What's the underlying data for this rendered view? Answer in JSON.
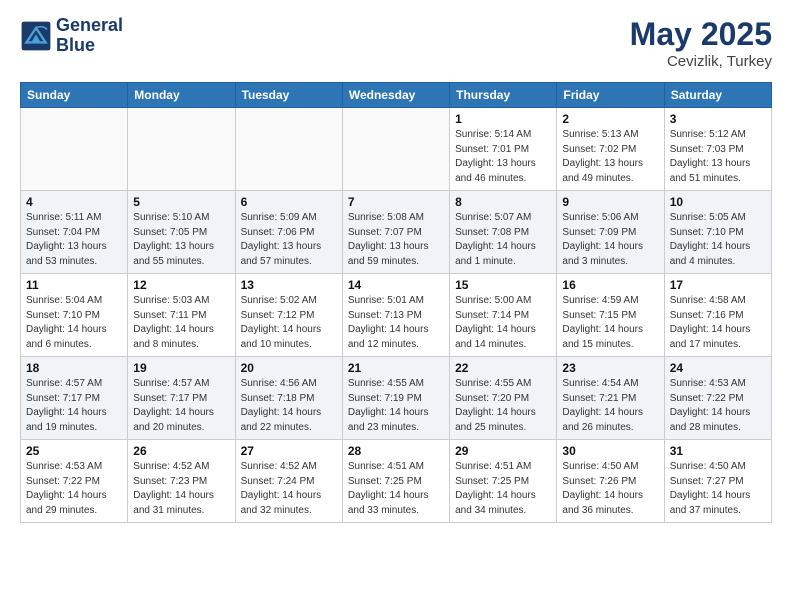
{
  "header": {
    "logo_line1": "General",
    "logo_line2": "Blue",
    "month_year": "May 2025",
    "location": "Cevizlik, Turkey"
  },
  "days_of_week": [
    "Sunday",
    "Monday",
    "Tuesday",
    "Wednesday",
    "Thursday",
    "Friday",
    "Saturday"
  ],
  "weeks": [
    [
      {
        "day": "",
        "info": ""
      },
      {
        "day": "",
        "info": ""
      },
      {
        "day": "",
        "info": ""
      },
      {
        "day": "",
        "info": ""
      },
      {
        "day": "1",
        "info": "Sunrise: 5:14 AM\nSunset: 7:01 PM\nDaylight: 13 hours\nand 46 minutes."
      },
      {
        "day": "2",
        "info": "Sunrise: 5:13 AM\nSunset: 7:02 PM\nDaylight: 13 hours\nand 49 minutes."
      },
      {
        "day": "3",
        "info": "Sunrise: 5:12 AM\nSunset: 7:03 PM\nDaylight: 13 hours\nand 51 minutes."
      }
    ],
    [
      {
        "day": "4",
        "info": "Sunrise: 5:11 AM\nSunset: 7:04 PM\nDaylight: 13 hours\nand 53 minutes."
      },
      {
        "day": "5",
        "info": "Sunrise: 5:10 AM\nSunset: 7:05 PM\nDaylight: 13 hours\nand 55 minutes."
      },
      {
        "day": "6",
        "info": "Sunrise: 5:09 AM\nSunset: 7:06 PM\nDaylight: 13 hours\nand 57 minutes."
      },
      {
        "day": "7",
        "info": "Sunrise: 5:08 AM\nSunset: 7:07 PM\nDaylight: 13 hours\nand 59 minutes."
      },
      {
        "day": "8",
        "info": "Sunrise: 5:07 AM\nSunset: 7:08 PM\nDaylight: 14 hours\nand 1 minute."
      },
      {
        "day": "9",
        "info": "Sunrise: 5:06 AM\nSunset: 7:09 PM\nDaylight: 14 hours\nand 3 minutes."
      },
      {
        "day": "10",
        "info": "Sunrise: 5:05 AM\nSunset: 7:10 PM\nDaylight: 14 hours\nand 4 minutes."
      }
    ],
    [
      {
        "day": "11",
        "info": "Sunrise: 5:04 AM\nSunset: 7:10 PM\nDaylight: 14 hours\nand 6 minutes."
      },
      {
        "day": "12",
        "info": "Sunrise: 5:03 AM\nSunset: 7:11 PM\nDaylight: 14 hours\nand 8 minutes."
      },
      {
        "day": "13",
        "info": "Sunrise: 5:02 AM\nSunset: 7:12 PM\nDaylight: 14 hours\nand 10 minutes."
      },
      {
        "day": "14",
        "info": "Sunrise: 5:01 AM\nSunset: 7:13 PM\nDaylight: 14 hours\nand 12 minutes."
      },
      {
        "day": "15",
        "info": "Sunrise: 5:00 AM\nSunset: 7:14 PM\nDaylight: 14 hours\nand 14 minutes."
      },
      {
        "day": "16",
        "info": "Sunrise: 4:59 AM\nSunset: 7:15 PM\nDaylight: 14 hours\nand 15 minutes."
      },
      {
        "day": "17",
        "info": "Sunrise: 4:58 AM\nSunset: 7:16 PM\nDaylight: 14 hours\nand 17 minutes."
      }
    ],
    [
      {
        "day": "18",
        "info": "Sunrise: 4:57 AM\nSunset: 7:17 PM\nDaylight: 14 hours\nand 19 minutes."
      },
      {
        "day": "19",
        "info": "Sunrise: 4:57 AM\nSunset: 7:17 PM\nDaylight: 14 hours\nand 20 minutes."
      },
      {
        "day": "20",
        "info": "Sunrise: 4:56 AM\nSunset: 7:18 PM\nDaylight: 14 hours\nand 22 minutes."
      },
      {
        "day": "21",
        "info": "Sunrise: 4:55 AM\nSunset: 7:19 PM\nDaylight: 14 hours\nand 23 minutes."
      },
      {
        "day": "22",
        "info": "Sunrise: 4:55 AM\nSunset: 7:20 PM\nDaylight: 14 hours\nand 25 minutes."
      },
      {
        "day": "23",
        "info": "Sunrise: 4:54 AM\nSunset: 7:21 PM\nDaylight: 14 hours\nand 26 minutes."
      },
      {
        "day": "24",
        "info": "Sunrise: 4:53 AM\nSunset: 7:22 PM\nDaylight: 14 hours\nand 28 minutes."
      }
    ],
    [
      {
        "day": "25",
        "info": "Sunrise: 4:53 AM\nSunset: 7:22 PM\nDaylight: 14 hours\nand 29 minutes."
      },
      {
        "day": "26",
        "info": "Sunrise: 4:52 AM\nSunset: 7:23 PM\nDaylight: 14 hours\nand 31 minutes."
      },
      {
        "day": "27",
        "info": "Sunrise: 4:52 AM\nSunset: 7:24 PM\nDaylight: 14 hours\nand 32 minutes."
      },
      {
        "day": "28",
        "info": "Sunrise: 4:51 AM\nSunset: 7:25 PM\nDaylight: 14 hours\nand 33 minutes."
      },
      {
        "day": "29",
        "info": "Sunrise: 4:51 AM\nSunset: 7:25 PM\nDaylight: 14 hours\nand 34 minutes."
      },
      {
        "day": "30",
        "info": "Sunrise: 4:50 AM\nSunset: 7:26 PM\nDaylight: 14 hours\nand 36 minutes."
      },
      {
        "day": "31",
        "info": "Sunrise: 4:50 AM\nSunset: 7:27 PM\nDaylight: 14 hours\nand 37 minutes."
      }
    ]
  ]
}
